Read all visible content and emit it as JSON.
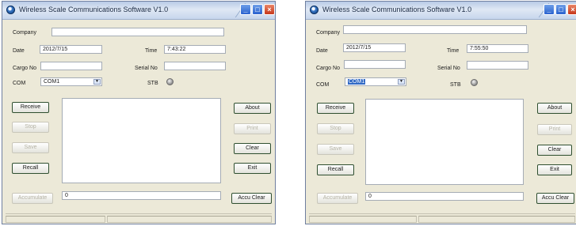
{
  "windows": [
    {
      "title": "Wireless Scale Communications Software V1.0",
      "company_label": "Company",
      "company_value": "",
      "date_label": "Date",
      "date_value": "2012/7/15",
      "time_label": "Time",
      "time_value": "7:43:22",
      "cargo_label": "Cargo No",
      "cargo_value": "",
      "serial_label": "Serial No",
      "serial_value": "",
      "com_label": "COM",
      "com_value": "COM1",
      "stb_label": "STB",
      "receive": "Receive",
      "stop": "Stop",
      "save": "Save",
      "recall": "Recall",
      "about": "About",
      "print": "Print",
      "clear": "Clear",
      "exit": "Exit",
      "accumulate": "Accumulate",
      "accu_value": "0",
      "accu_clear": "Accu Clear"
    },
    {
      "title": "Wireless Scale Communications Software V1.0",
      "company_label": "Company",
      "company_value": "",
      "date_label": "Date",
      "date_value": "2012/7/15",
      "time_label": "Time",
      "time_value": "7:55:50",
      "cargo_label": "Cargo No",
      "cargo_value": "",
      "serial_label": "Serial No",
      "serial_value": "",
      "com_label": "COM",
      "com_value": "COM1",
      "stb_label": "STB",
      "receive": "Receive",
      "stop": "Stop",
      "save": "Save",
      "recall": "Recall",
      "about": "About",
      "print": "Print",
      "clear": "Clear",
      "exit": "Exit",
      "accumulate": "Accumulate",
      "accu_value": "0",
      "accu_clear": "Accu Clear"
    }
  ],
  "icons": {
    "minimize": "minimize-icon",
    "maximize": "maximize-icon",
    "close": "close-icon",
    "app": "app-icon",
    "dropdown": "chevron-down-icon",
    "stb_led": "status-led-icon"
  },
  "colors": {
    "title_bar": "#c7d6ec",
    "window_bg": "#ece9d8",
    "selection": "#316ac5",
    "close_button": "#c6371b"
  }
}
